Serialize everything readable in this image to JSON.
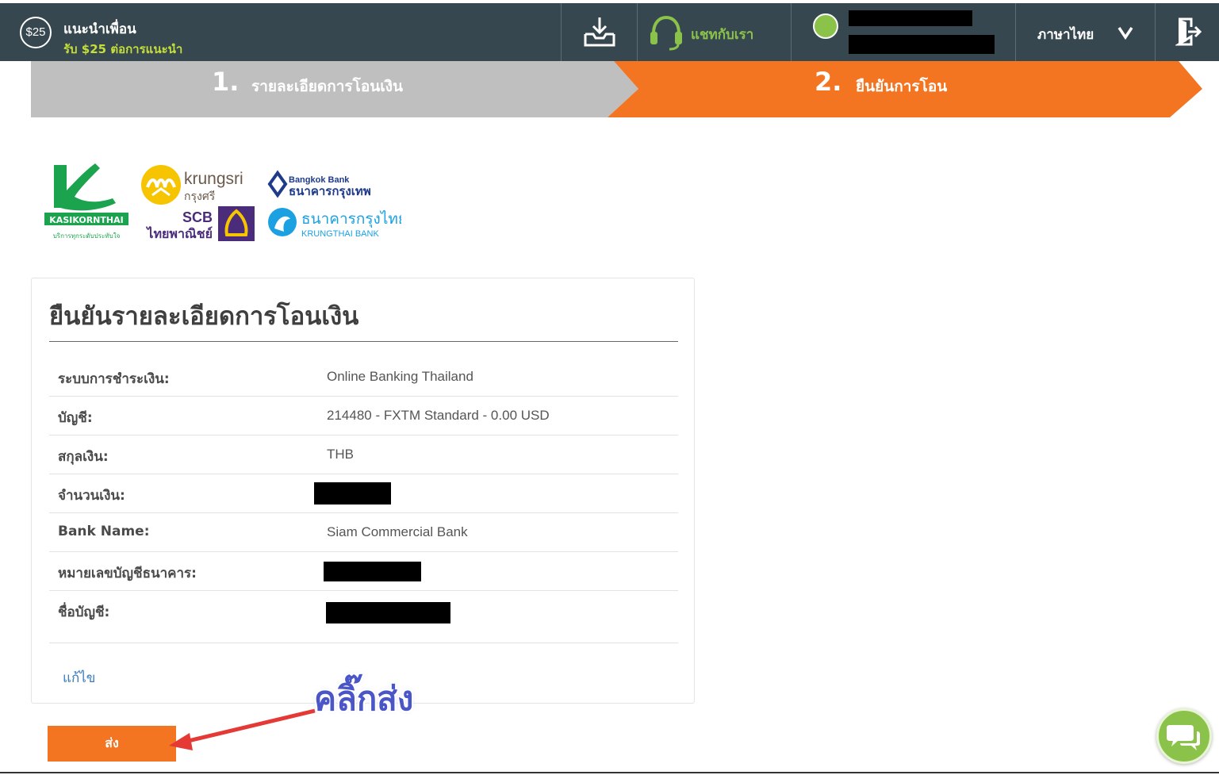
{
  "header": {
    "refer_badge": "$25",
    "refer_title": "แนะนำเพื่อน",
    "refer_subtitle": "รับ $25 ต่อการแนะนำ",
    "chat_label": "แชทกับเรา",
    "language_label": "ภาษาไทย",
    "icons": {
      "download": "download-tray-icon",
      "chat": "headset-icon",
      "status": "online-status-icon",
      "language": "chevron-down-icon",
      "logout": "logout-icon"
    },
    "colors": {
      "bar": "#37474f",
      "accent_green": "#8bc34a",
      "subtitle": "#c4df3a"
    }
  },
  "steps": [
    {
      "number": "1.",
      "label": "รายละเอียดการโอนเงิน",
      "active": false
    },
    {
      "number": "2.",
      "label": "ยืนยันการโอน",
      "active": true
    }
  ],
  "banks": {
    "kasikorn": {
      "name": "KASIKORNTHAI",
      "tagline": "บริการทุกระดับประทับใจ"
    },
    "krungsri": {
      "name": "krungsri",
      "thai": "กรุงศรี"
    },
    "scb": {
      "name": "SCB",
      "thai": "ไทยพาณิชย์"
    },
    "bangkok": {
      "name": "Bangkok Bank",
      "thai": "ธนาคารกรุงเทพ"
    },
    "krungthai": {
      "name": "KRUNGTHAI BANK",
      "thai": "ธนาคารกรุงไทย"
    }
  },
  "confirm": {
    "title": "ยืนยันรายละเอียดการโอนเงิน",
    "rows": [
      {
        "label": "ระบบการชำระเงิน:",
        "value": "Online Banking Thailand"
      },
      {
        "label": "บัญชี:",
        "value": "214480 - FXTM Standard - 0.00 USD"
      },
      {
        "label": "สกุลเงิน:",
        "value": "THB"
      },
      {
        "label": "จำนวนเงิน:",
        "value": ""
      },
      {
        "label": "Bank Name:",
        "value": "Siam Commercial Bank"
      },
      {
        "label": "หมายเลขบัญชีธนาคาร:",
        "value": ""
      },
      {
        "label": "ชื่อบัญชี:",
        "value": ""
      }
    ],
    "edit_label": "แก้ไข",
    "submit_label": "ส่ง"
  },
  "annotation": {
    "text": "คลิ๊กส่ง",
    "color": "#4a55c7"
  },
  "colors": {
    "step_active": "#f37421",
    "step_inactive": "#bfbfbf",
    "button": "#f37421",
    "link": "#3b7bbf"
  }
}
